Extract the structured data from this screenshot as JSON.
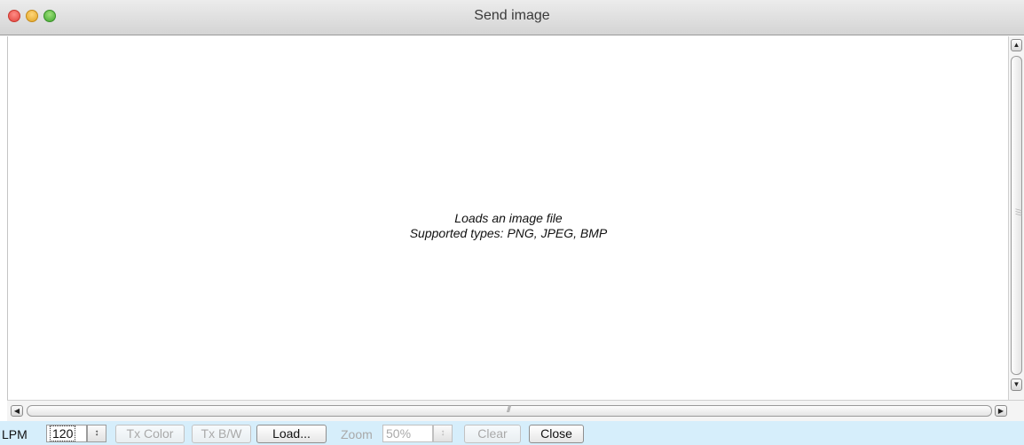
{
  "window": {
    "title": "Send image"
  },
  "canvas": {
    "hint_line1": "Loads an image file",
    "hint_line2": "Supported types: PNG, JPEG, BMP"
  },
  "toolbar": {
    "lpm_label": "LPM",
    "lpm_value": "120",
    "tx_color_label": "Tx Color",
    "tx_bw_label": "Tx B/W",
    "load_label": "Load...",
    "zoom_label": "Zoom",
    "zoom_value": "50%",
    "clear_label": "Clear",
    "close_label": "Close"
  },
  "icons": {
    "spinner": "↕",
    "arrow_up": "▲",
    "arrow_down": "▼",
    "arrow_left": "◀",
    "arrow_right": "▶",
    "grip": "///"
  },
  "colors": {
    "toolbar_bg": "#d6eefb",
    "close_light": "#e0443e",
    "min_light": "#e0a424",
    "max_light": "#41a82f"
  }
}
